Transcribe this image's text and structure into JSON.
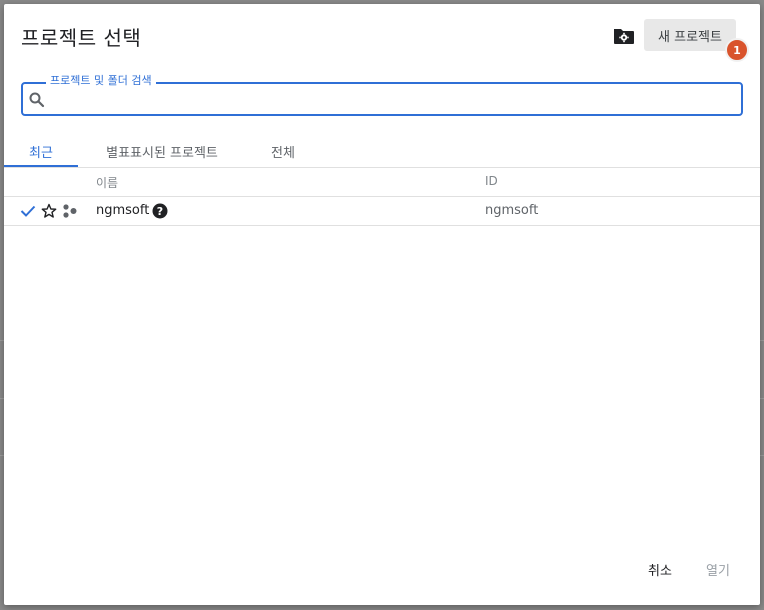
{
  "dialog": {
    "title": "프로젝트 선택",
    "manage_icon": "folder-gear-icon",
    "new_project_label": "새 프로젝트",
    "badge_count": "1"
  },
  "search": {
    "label": "프로젝트 및 폴더 검색",
    "value": "",
    "placeholder": ""
  },
  "tabs": [
    {
      "label": "최근",
      "active": true
    },
    {
      "label": "별표표시된 프로젝트",
      "active": false
    },
    {
      "label": "전체",
      "active": false
    }
  ],
  "table": {
    "headers": {
      "name": "이름",
      "id": "ID"
    },
    "rows": [
      {
        "selected": true,
        "starred": false,
        "type_icon": "project-dots-icon",
        "name": "ngmsoft",
        "id": "ngmsoft"
      }
    ]
  },
  "footer": {
    "cancel_label": "취소",
    "open_label": "열기"
  },
  "colors": {
    "accent": "#2f6fd6",
    "badge": "#d9532c"
  }
}
